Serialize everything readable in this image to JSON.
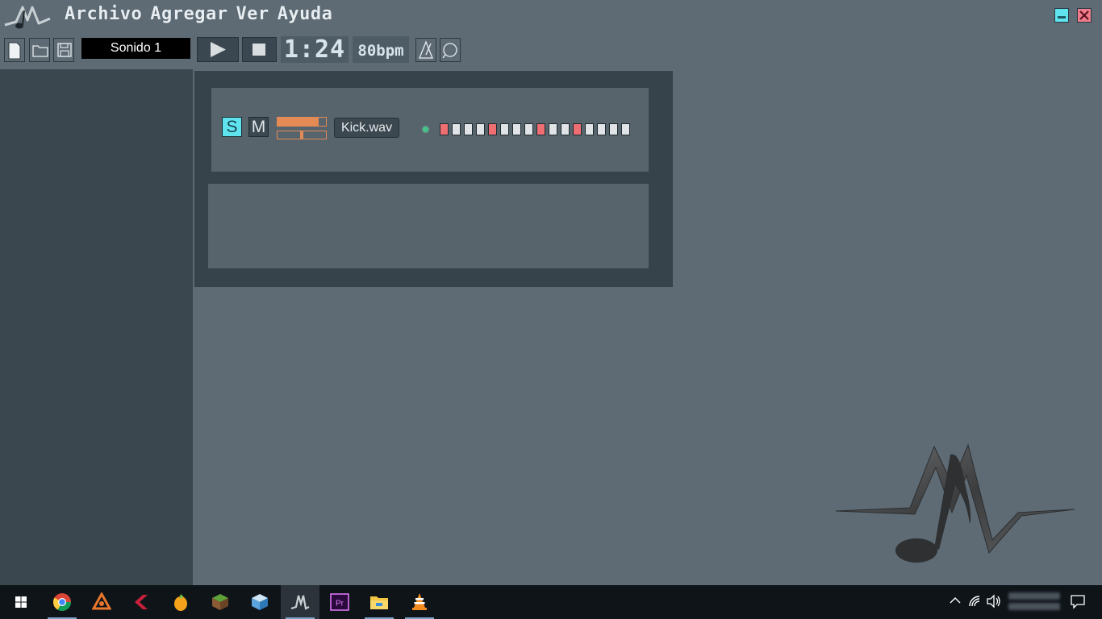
{
  "menu": {
    "items": [
      "Archivo",
      "Agregar",
      "Ver",
      "Ayuda"
    ]
  },
  "window_controls": {
    "minimize_color": "#5fe4ef",
    "close_color": "#f07b8a"
  },
  "toolbar": {
    "new_icon": "new-file-icon",
    "open_icon": "folder-icon",
    "save_icon": "save-icon",
    "sound_name": "Sonido 1",
    "play_icon": "play-icon",
    "stop_icon": "stop-icon",
    "time": "1:24",
    "bpm": "80bpm",
    "metronome_icon": "metronome-icon",
    "loop_icon": "loop-icon"
  },
  "channel": {
    "solo_label": "S",
    "mute_label": "M",
    "solo_active": true,
    "volume": 0.85,
    "pan": 0.5,
    "sample": "Kick.wav",
    "steps": [
      true,
      false,
      false,
      false,
      true,
      false,
      false,
      false,
      true,
      false,
      false,
      true,
      false,
      false,
      false,
      false
    ],
    "step_on_color": "#ef6e72",
    "accent_color": "#e38a55"
  },
  "taskbar": {
    "apps": [
      {
        "name": "windows-start",
        "icon": "windows-icon",
        "running": false
      },
      {
        "name": "chrome",
        "icon": "chrome-icon",
        "running": true
      },
      {
        "name": "reason",
        "icon": "reason-icon",
        "running": false
      },
      {
        "name": "cubase",
        "icon": "cubase-icon",
        "running": false
      },
      {
        "name": "fl-studio",
        "icon": "fl-studio-icon",
        "running": false
      },
      {
        "name": "minecraft",
        "icon": "minecraft-icon",
        "running": false
      },
      {
        "name": "virtualbox",
        "icon": "cube-icon",
        "running": false
      },
      {
        "name": "music-app",
        "icon": "app-logo-icon",
        "running": true,
        "active": true
      },
      {
        "name": "premiere",
        "icon": "premiere-icon",
        "running": false
      },
      {
        "name": "file-explorer",
        "icon": "folder-icon",
        "running": true
      },
      {
        "name": "vlc",
        "icon": "vlc-icon",
        "running": true
      }
    ]
  }
}
